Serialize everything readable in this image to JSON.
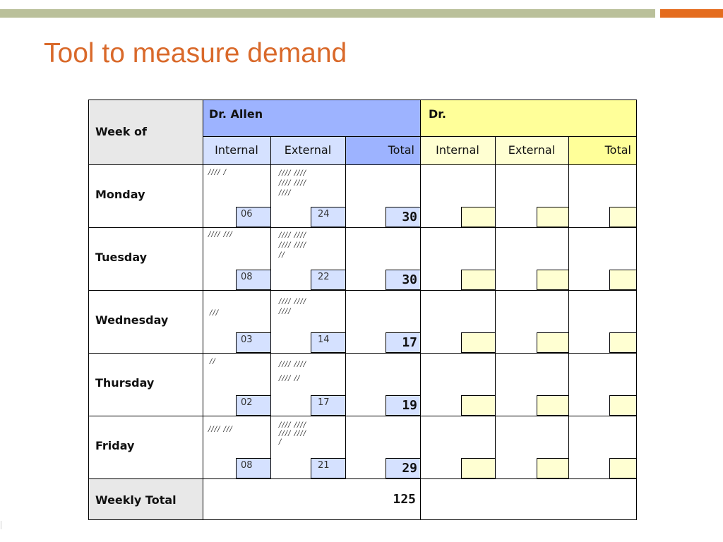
{
  "slide": {
    "title": "Tool to measure demand"
  },
  "table": {
    "week_of_label": "Week of",
    "doctor1": {
      "name": "Dr. Allen",
      "internal": "Internal",
      "external": "External",
      "total": "Total"
    },
    "doctor2": {
      "name": "Dr.",
      "internal": "Internal",
      "external": "External",
      "total": "Total"
    },
    "days": [
      {
        "name": "Monday",
        "internal_tally": "//// /",
        "external_tally": [
          "//// ////",
          "//// ////",
          "////"
        ],
        "internal": "06",
        "external": "24",
        "total": "30"
      },
      {
        "name": "Tuesday",
        "internal_tally": "//// ///",
        "external_tally": [
          "//// ////",
          "//// ////",
          "//"
        ],
        "internal": "08",
        "external": "22",
        "total": "30"
      },
      {
        "name": "Wednesday",
        "internal_tally": "///",
        "external_tally": [
          "//// ////",
          "////"
        ],
        "internal": "03",
        "external": "14",
        "total": "17"
      },
      {
        "name": "Thursday",
        "internal_tally": "//",
        "external_tally": [
          "//// ////",
          "//// //"
        ],
        "internal": "02",
        "external": "17",
        "total": "19"
      },
      {
        "name": "Friday",
        "internal_tally": "//// ///",
        "external_tally": [
          "//// ////",
          "//// ////",
          "/"
        ],
        "internal": "08",
        "external": "21",
        "total": "29"
      }
    ],
    "weekly_total_label": "Weekly Total",
    "weekly_total": "125"
  },
  "colors": {
    "title": "#D9692A",
    "top_bar": "#BAC09A",
    "accent": "#E46C1E",
    "doctor1_header": "#9DB3FF",
    "doctor1_light": "#D5E1FF",
    "doctor2_header": "#FFFF99",
    "doctor2_light": "#FFFFD2",
    "label_bg": "#E8E8E8"
  }
}
